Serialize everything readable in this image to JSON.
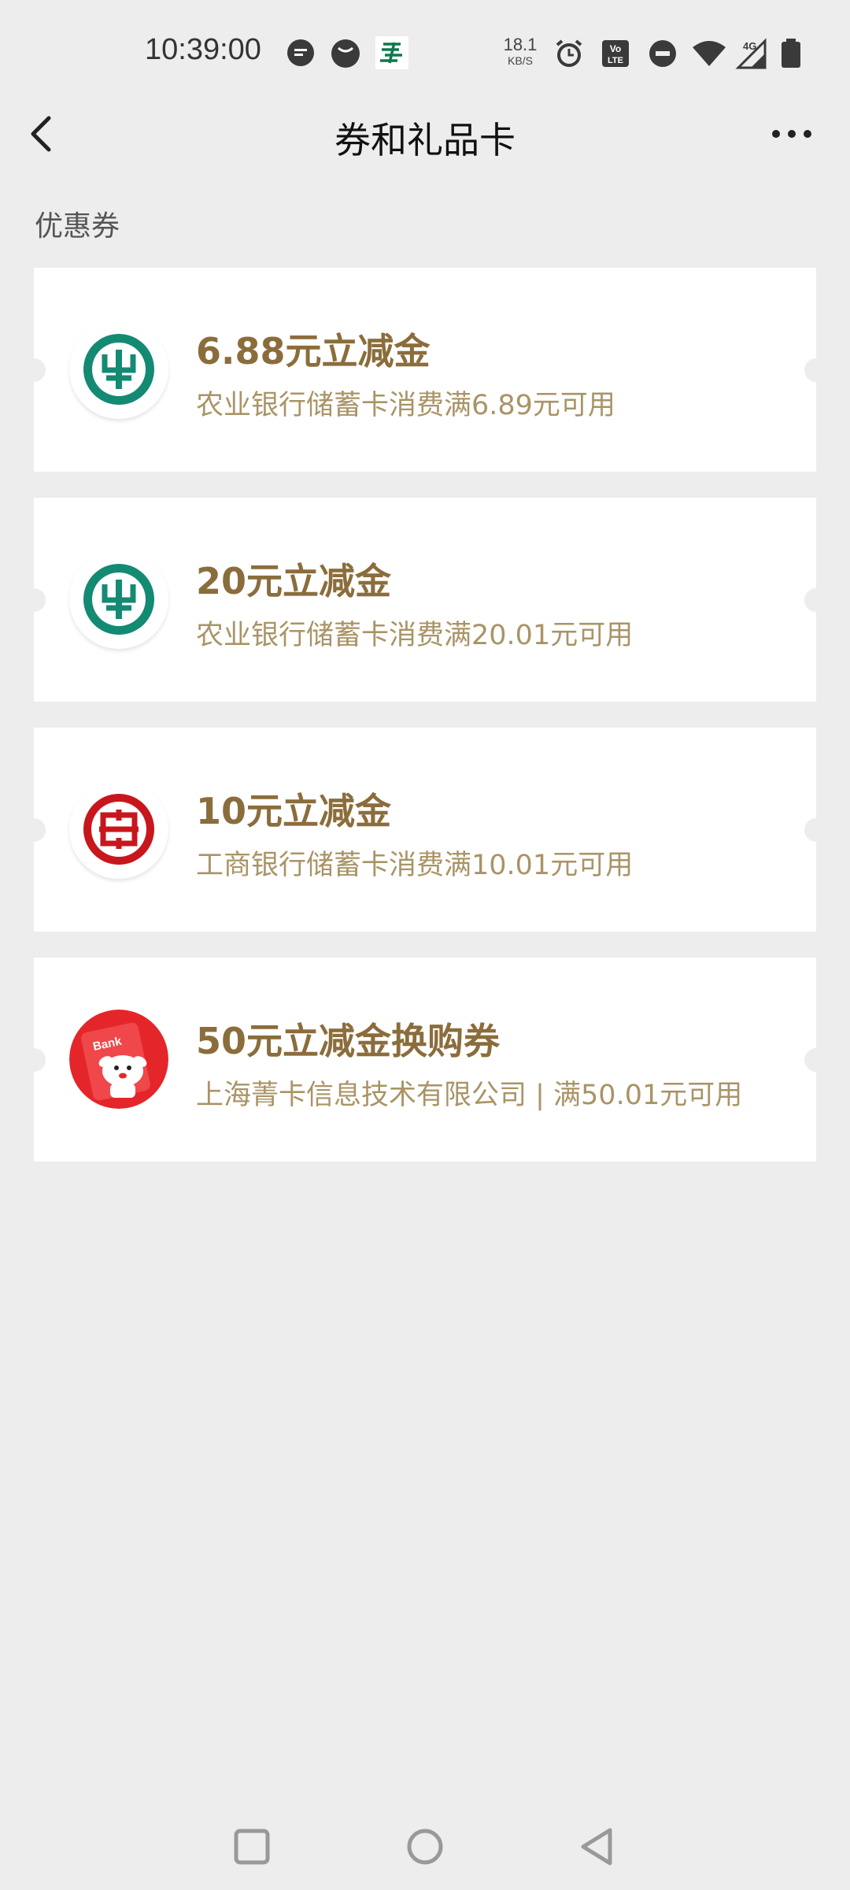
{
  "status_bar": {
    "time": "10:39:00",
    "net_speed_value": "18.1",
    "net_speed_unit": "KB/S",
    "icons": [
      "message-bubble-icon",
      "smiley-icon",
      "china-post-app-icon",
      "alarm-icon",
      "volte-icon",
      "do-not-disturb-icon",
      "wifi-icon",
      "signal-4g-icon",
      "battery-icon"
    ],
    "volte_label": "Vo LTE",
    "network_label": "4G"
  },
  "header": {
    "title": "券和礼品卡",
    "back_icon": "chevron-left-icon",
    "more_icon": "more-dots-icon"
  },
  "section": {
    "label": "优惠券"
  },
  "coupons": [
    {
      "title": "6.88元立减金",
      "description": "农业银行储蓄卡消费满6.89元可用",
      "logo": "abc-bank-logo"
    },
    {
      "title": "20元立减金",
      "description": "农业银行储蓄卡消费满20.01元可用",
      "logo": "abc-bank-logo"
    },
    {
      "title": "10元立减金",
      "description": "工商银行储蓄卡消费满10.01元可用",
      "logo": "icbc-bank-logo"
    },
    {
      "title": "50元立减金换购券",
      "description": "上海菁卡信息技术有限公司 | 满50.01元可用",
      "logo": "jd-finance-mascot-logo",
      "logo_text": "Bank"
    }
  ],
  "colors": {
    "background": "#ededed",
    "card": "#ffffff",
    "coupon_title": "#8b6d3c",
    "coupon_desc": "#a99466",
    "abc_green": "#148a73",
    "icbc_red": "#c8161d",
    "jd_red": "#e4262a"
  },
  "nav_bar": {
    "icons": [
      "recents-square-icon",
      "home-circle-icon",
      "back-triangle-icon"
    ]
  }
}
